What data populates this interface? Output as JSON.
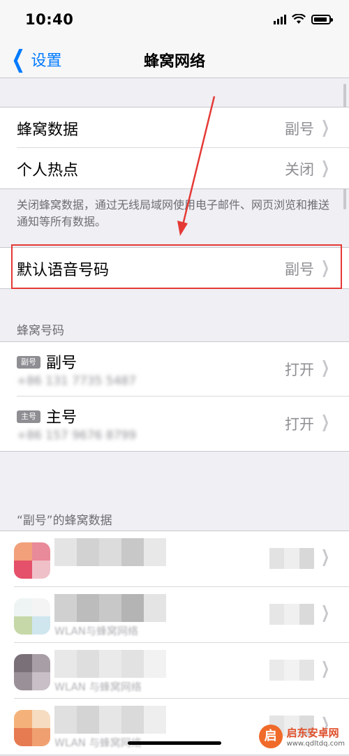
{
  "status_bar": {
    "time": "10:40"
  },
  "nav": {
    "back_label": "设置",
    "title": "蜂窝网络"
  },
  "group1": {
    "rows": [
      {
        "label": "蜂窝数据",
        "value": "副号"
      },
      {
        "label": "个人热点",
        "value": "关闭"
      }
    ],
    "footer": "关闭蜂窝数据，通过无线局域网使用电子邮件、网页浏览和推送通知等所有数据。"
  },
  "group2": {
    "label": "默认语音号码",
    "value": "副号"
  },
  "sims": {
    "header": "蜂窝号码",
    "items": [
      {
        "badge": "副号",
        "label": "副号",
        "number": "+86 131 7735 5487",
        "value": "打开"
      },
      {
        "badge": "主号",
        "label": "主号",
        "number": "+86 157 9676 8799",
        "value": "打开"
      }
    ]
  },
  "apps": {
    "header": "“副号”的蜂窝数据",
    "items": [
      {
        "subtitle": ""
      },
      {
        "subtitle": "WLAN与蜂窝网络"
      },
      {
        "subtitle": "WLAN 与蜂窝网络"
      },
      {
        "subtitle": "WLAN 与蜂窝网络"
      }
    ]
  },
  "watermark": {
    "title": "启东安卓网",
    "url": "www.qdltdq.com",
    "logo": "启"
  },
  "colors": {
    "accent": "#007aff",
    "annotation": "#e53935"
  }
}
